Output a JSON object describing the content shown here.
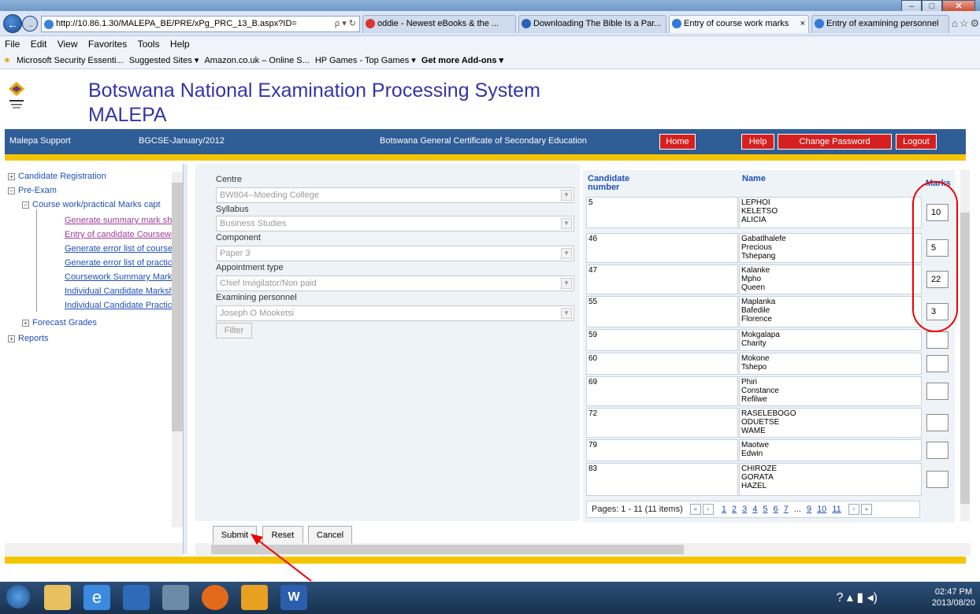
{
  "browser": {
    "url": "http://10.86.1.30/MALEPA_BE/PRE/xPg_PRC_13_B.aspx?ID=",
    "search_glyph": "ρ ▾ ↻",
    "tabs": [
      {
        "label": "oddie - Newest eBooks & the ..."
      },
      {
        "label": "Downloading The Bible Is a Par..."
      },
      {
        "label": "Entry of course work marks"
      },
      {
        "label": "Entry of examining personnel"
      }
    ],
    "menu": [
      "File",
      "Edit",
      "View",
      "Favorites",
      "Tools",
      "Help"
    ],
    "favorites": [
      "Microsoft Security Essenti...",
      "Suggested Sites ▾",
      "Amazon.co.uk – Online S...",
      "HP Games - Top Games ▾",
      "Get more Add-ons ▾"
    ]
  },
  "app": {
    "title_line1": "Botswana National Examination Processing System",
    "title_line2": "MALEPA",
    "bar_left": "Malepa Support",
    "bar_session": "BGCSE-January/2012",
    "bar_center": "Botswana General Certificate of Secondary Education",
    "nav": {
      "home": "Home",
      "help": "Help",
      "change_password": "Change Password",
      "logout": "Logout"
    }
  },
  "tree": {
    "candidate_registration": "Candidate Registration",
    "pre_exam": "Pre-Exam",
    "course_work": "Course work/practical Marks capt",
    "links": [
      "Generate summary mark she",
      "Entry of candidate Coursewo",
      "Generate error list of course",
      "Generate error list of practica",
      "Coursework Summary Marksh",
      "Individual Candidate Markshe",
      "Individual Candidate Practical"
    ],
    "forecast": "Forecast Grades",
    "reports": "Reports"
  },
  "form": {
    "centre_label": "Centre",
    "centre_value": "BW804--Moeding College",
    "syllabus_label": "Syllabus",
    "syllabus_value": "Business Studies",
    "component_label": "Component",
    "component_value": "Paper 3",
    "appointment_label": "Appointment type",
    "appointment_value": "Chief Invigilator/Non paid",
    "examiner_label": "Examining personnel",
    "examiner_value": "Joseph O Mooketsi",
    "filter": "Filter"
  },
  "grid": {
    "col_number_1": "Candidate",
    "col_number_2": "number",
    "col_name": "Name",
    "col_marks": "Marks",
    "rows": [
      {
        "number": "5",
        "n1": "LEPHOI",
        "n2": "KELETSO",
        "n3": "ALICIA",
        "mark": "10"
      },
      {
        "number": "46",
        "n1": "Gabatlhalefe",
        "n2": "Precious",
        "n3": "Tshepang",
        "mark": "5"
      },
      {
        "number": "47",
        "n1": "Kalanke",
        "n2": "Mpho",
        "n3": "Queen",
        "mark": "22"
      },
      {
        "number": "55",
        "n1": "Maplanka",
        "n2": "Bafedile",
        "n3": "Florence",
        "mark": "3"
      },
      {
        "number": "59",
        "n1": "Mokgalapa",
        "n2": "Charity",
        "n3": "",
        "mark": ""
      },
      {
        "number": "60",
        "n1": "Mokone",
        "n2": "Tshepo",
        "n3": "",
        "mark": ""
      },
      {
        "number": "69",
        "n1": "Phiri",
        "n2": "Constance",
        "n3": "Refilwe",
        "mark": ""
      },
      {
        "number": "72",
        "n1": "RASELEBOGO",
        "n2": "ODUETSE",
        "n3": "WAME",
        "mark": ""
      },
      {
        "number": "79",
        "n1": "Maotwe",
        "n2": "Edwin",
        "n3": "",
        "mark": ""
      },
      {
        "number": "83",
        "n1": "CHIROZE",
        "n2": "GORATA",
        "n3": "HAZEL",
        "mark": ""
      }
    ],
    "pager_text": "Pages: 1 - 11 (11 items)",
    "pages": [
      "1",
      "2",
      "3",
      "4",
      "5",
      "6",
      "7",
      "...",
      "9",
      "10",
      "11"
    ]
  },
  "actions": {
    "submit": "Submit",
    "reset": "Reset",
    "cancel": "Cancel"
  },
  "taskbar": {
    "time": "02:47 PM",
    "date": "2013/08/20"
  },
  "colors": {
    "brand_blue": "#2f5d96",
    "accent_yellow": "#f5c400",
    "nav_red": "#d62020",
    "title_purple": "#3434a8"
  }
}
